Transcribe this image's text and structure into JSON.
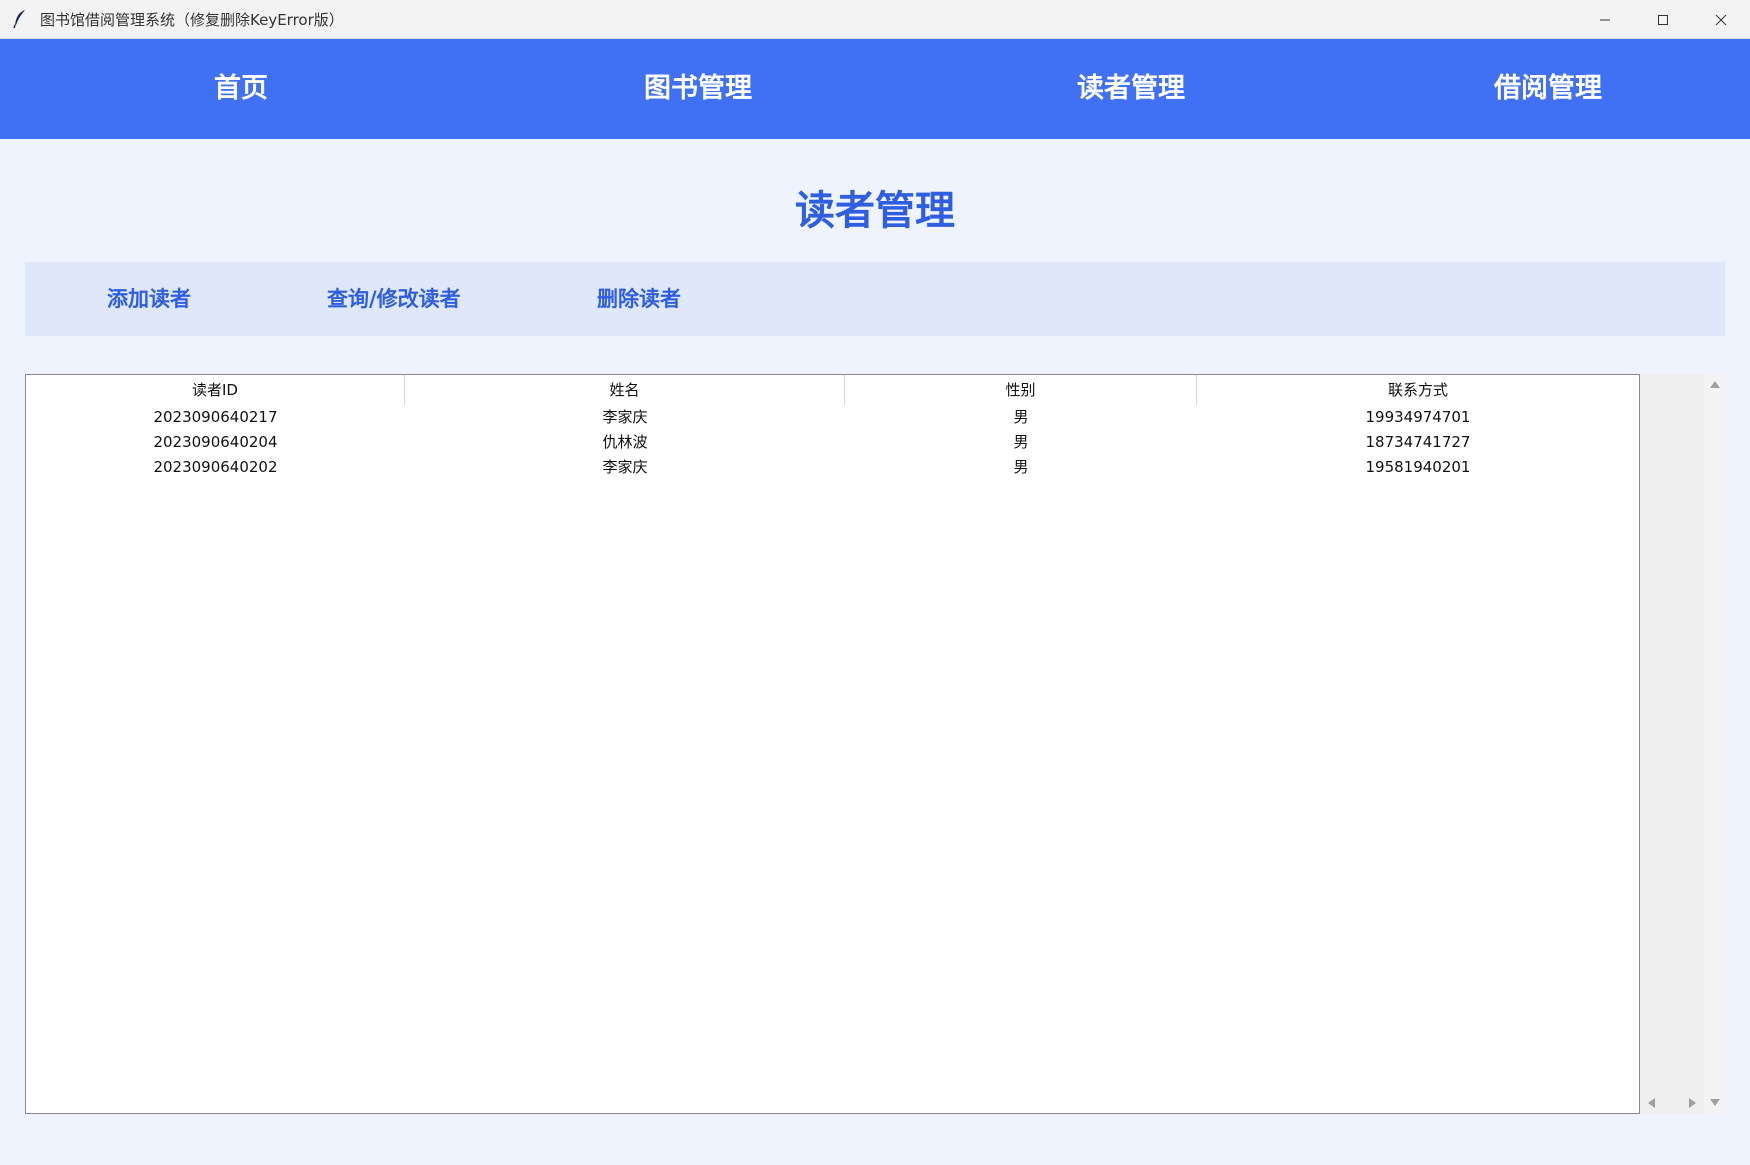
{
  "window": {
    "title": "图书馆借阅管理系统（修复删除KeyError版）"
  },
  "nav": {
    "items": [
      "首页",
      "图书管理",
      "读者管理",
      "借阅管理"
    ]
  },
  "page": {
    "title": "读者管理"
  },
  "actions": {
    "items": [
      "添加读者",
      "查询/修改读者",
      "删除读者"
    ]
  },
  "table": {
    "columns": [
      "读者ID",
      "姓名",
      "性别",
      "联系方式"
    ],
    "rows": [
      [
        "2023090640217",
        "李家庆",
        "男",
        "19934974701"
      ],
      [
        "2023090640204",
        "仇林波",
        "男",
        "18734741727"
      ],
      [
        "2023090640202",
        "李家庆",
        "男",
        "19581940201"
      ]
    ]
  },
  "colors": {
    "nav_bg": "#4070f4",
    "accent": "#2f5fe0",
    "page_bg": "#eef3fd",
    "action_bar_bg": "#dfe7fb"
  },
  "icons": {
    "app": "feather-icon",
    "minimize": "minimize-icon",
    "maximize": "maximize-icon",
    "close": "close-icon"
  }
}
